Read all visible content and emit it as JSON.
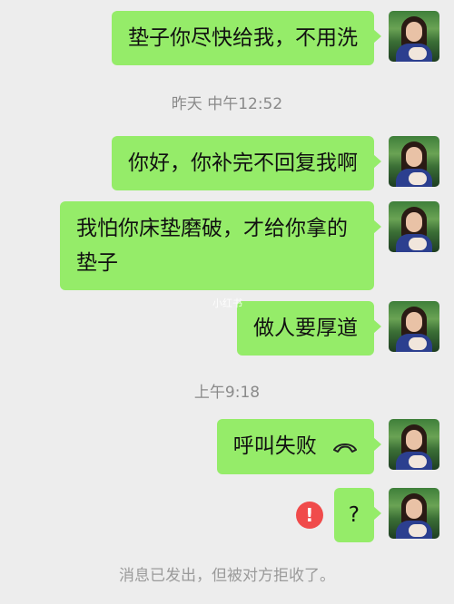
{
  "messages": [
    {
      "text": "垫子你尽快给我，不用洗"
    },
    {
      "text": "你好，你补完不回复我啊"
    },
    {
      "text": "我怕你床垫磨破，才给你拿的垫子"
    },
    {
      "text": "做人要厚道"
    },
    {
      "text": "呼叫失败"
    },
    {
      "text": "?"
    }
  ],
  "timestamps": {
    "t1": "昨天 中午12:52",
    "t2": "上午9:18"
  },
  "system_notice": "消息已发出，但被对方拒收了。",
  "watermark": "小红书",
  "icons": {
    "call": "phone-hangup-icon",
    "error": "exclamation-error-icon",
    "avatar": "user-avatar"
  },
  "colors": {
    "bubble": "#95ec69",
    "background": "#ededed",
    "error": "#f04b4b"
  }
}
